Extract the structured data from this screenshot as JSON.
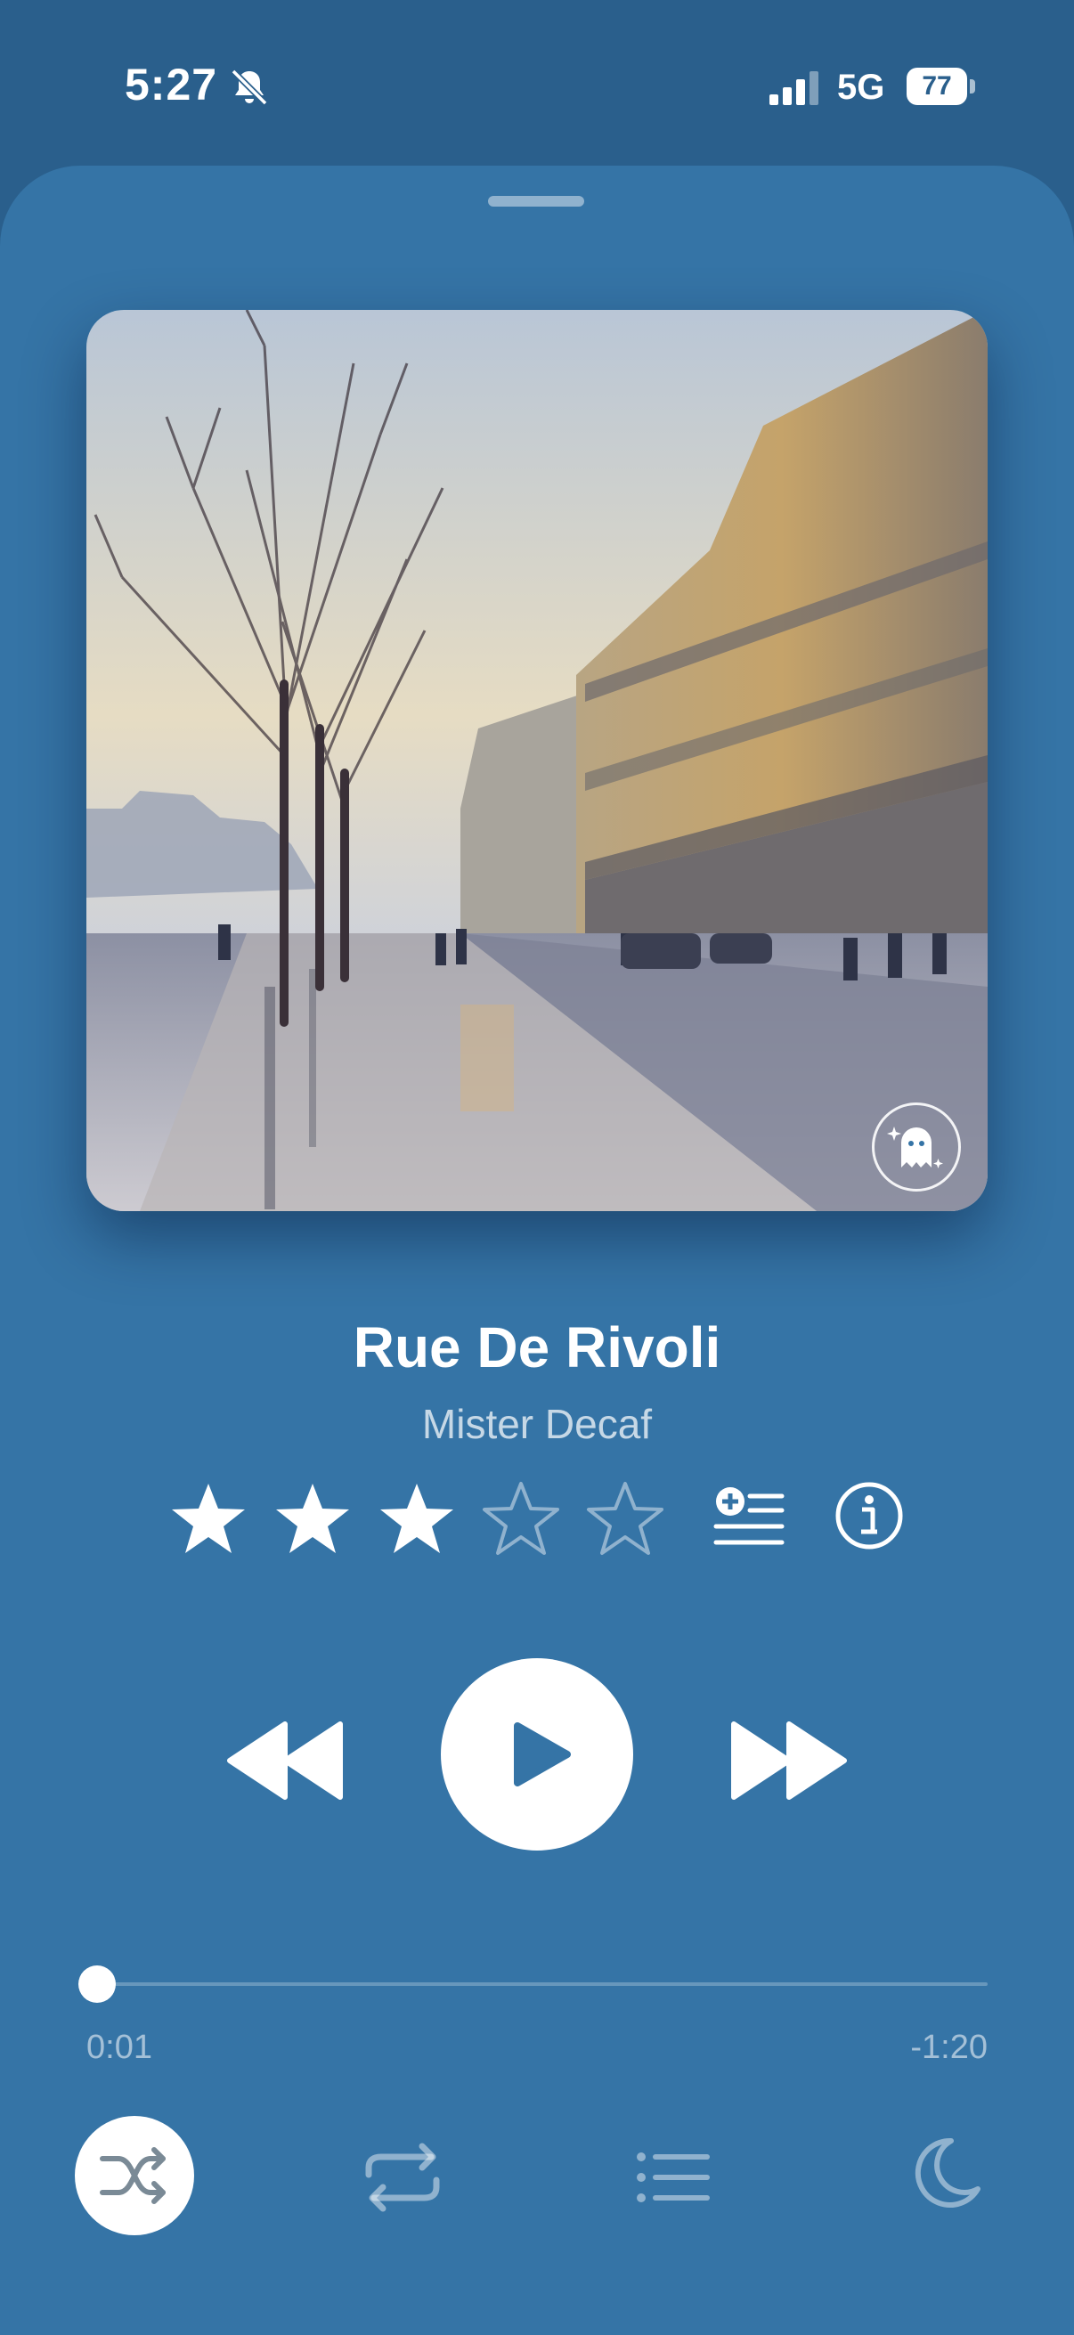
{
  "status_bar": {
    "time": "5:27",
    "network": "5G",
    "battery": "77",
    "icons": [
      "bell-slash-icon",
      "cellular-signal-icon",
      "battery-icon"
    ]
  },
  "now_playing": {
    "title": "Rue De Rivoli",
    "artist": "Mister Decaf",
    "artwork_badge_icon": "ghost-icon",
    "rating": 3,
    "rating_max": 5
  },
  "playback": {
    "elapsed": "0:01",
    "remaining": "-1:20",
    "progress_fraction": 0.012,
    "state": "paused"
  },
  "controls": {
    "rewind_icon": "rewind-icon",
    "play_icon": "play-icon",
    "forward_icon": "fast-forward-icon",
    "shuffle_icon": "shuffle-icon",
    "shuffle_active": true,
    "repeat_icon": "repeat-icon",
    "queue_icon": "list-icon",
    "sleep_icon": "moon-icon",
    "add_to_queue_icon": "add-to-queue-icon",
    "info_icon": "info-icon"
  },
  "colors": {
    "background": "#2a5f8c",
    "sheet": "#3574a6",
    "accent": "#ffffff"
  }
}
